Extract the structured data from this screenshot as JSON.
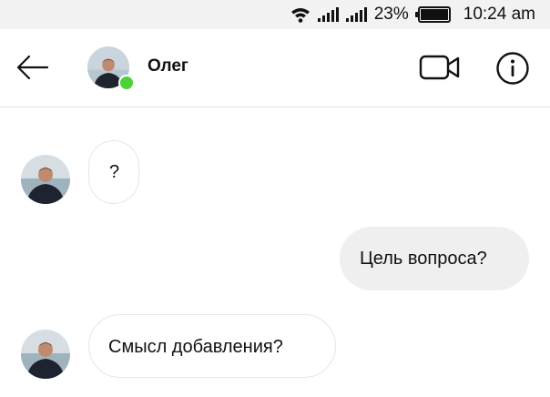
{
  "status_bar": {
    "battery": "23%",
    "time": "10:24 am"
  },
  "header": {
    "contact_name": "Олег",
    "online": true
  },
  "messages": [
    {
      "direction": "incoming",
      "text": "?"
    },
    {
      "direction": "outgoing",
      "text": "Цель вопроса?"
    },
    {
      "direction": "incoming",
      "text": "Смысл добавления?"
    }
  ],
  "colors": {
    "online_dot": "#4cd137",
    "outgoing_bubble": "#efefef",
    "status_bar_bg": "#f2f2f2"
  }
}
